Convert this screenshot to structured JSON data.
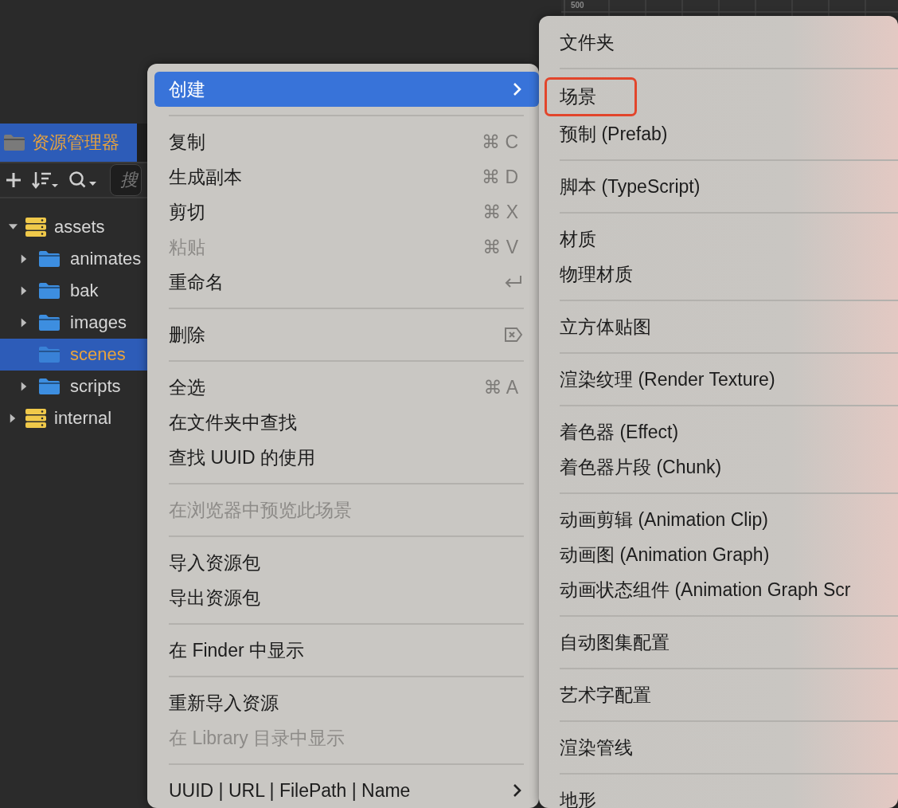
{
  "scene_view": {
    "ruler_label": "500"
  },
  "asset_panel": {
    "title": "资源管理器",
    "search": {
      "placeholder": "搜"
    },
    "tree": [
      {
        "label": "assets",
        "kind": "database",
        "expandable": true,
        "expanded": true,
        "selected": false,
        "children": [
          {
            "label": "animates",
            "kind": "folder",
            "expandable": true,
            "expanded": false,
            "selected": false
          },
          {
            "label": "bak",
            "kind": "folder",
            "expandable": true,
            "expanded": false,
            "selected": false
          },
          {
            "label": "images",
            "kind": "folder",
            "expandable": true,
            "expanded": false,
            "selected": false
          },
          {
            "label": "scenes",
            "kind": "folder",
            "expandable": false,
            "expanded": false,
            "selected": true
          },
          {
            "label": "scripts",
            "kind": "folder",
            "expandable": true,
            "expanded": false,
            "selected": false
          }
        ]
      },
      {
        "label": "internal",
        "kind": "database",
        "expandable": true,
        "expanded": false,
        "selected": false
      }
    ]
  },
  "context_menu": {
    "groups": [
      [
        {
          "label": "创建",
          "selected": true,
          "disabled": false,
          "submenu": true
        }
      ],
      [
        {
          "label": "复制",
          "shortcut": "⌘ C",
          "selected": false,
          "disabled": false,
          "submenu": false
        },
        {
          "label": "生成副本",
          "shortcut": "⌘ D",
          "selected": false,
          "disabled": false,
          "submenu": false
        },
        {
          "label": "剪切",
          "shortcut": "⌘ X",
          "selected": false,
          "disabled": false,
          "submenu": false
        },
        {
          "label": "粘贴",
          "shortcut": "⌘ V",
          "selected": false,
          "disabled": true,
          "submenu": false
        },
        {
          "label": "重命名",
          "kind": "return",
          "selected": false,
          "disabled": false,
          "submenu": false
        }
      ],
      [
        {
          "label": "删除",
          "kind": "delete",
          "selected": false,
          "disabled": false,
          "submenu": false
        }
      ],
      [
        {
          "label": "全选",
          "shortcut": "⌘ A",
          "selected": false,
          "disabled": false,
          "submenu": false
        },
        {
          "label": "在文件夹中查找",
          "selected": false,
          "disabled": false,
          "submenu": false
        },
        {
          "label": "查找 UUID 的使用",
          "selected": false,
          "disabled": false,
          "submenu": false
        }
      ],
      [
        {
          "label": "在浏览器中预览此场景",
          "selected": false,
          "disabled": true,
          "submenu": false
        }
      ],
      [
        {
          "label": "导入资源包",
          "selected": false,
          "disabled": false,
          "submenu": false
        },
        {
          "label": "导出资源包",
          "selected": false,
          "disabled": false,
          "submenu": false
        }
      ],
      [
        {
          "label": "在 Finder 中显示",
          "selected": false,
          "disabled": false,
          "submenu": false
        }
      ],
      [
        {
          "label": "重新导入资源",
          "selected": false,
          "disabled": false,
          "submenu": false
        },
        {
          "label": "在 Library 目录中显示",
          "selected": false,
          "disabled": true,
          "submenu": false
        }
      ],
      [
        {
          "label": "UUID | URL | FilePath | Name",
          "selected": false,
          "disabled": false,
          "submenu": true
        }
      ]
    ]
  },
  "create_submenu": {
    "groups": [
      [
        {
          "label": "文件夹",
          "outlined": false
        }
      ],
      [
        {
          "label": "场景",
          "outlined": true
        },
        {
          "label": "预制 (Prefab)",
          "outlined": false
        }
      ],
      [
        {
          "label": "脚本 (TypeScript)",
          "outlined": false
        }
      ],
      [
        {
          "label": "材质",
          "outlined": false
        },
        {
          "label": "物理材质",
          "outlined": false
        }
      ],
      [
        {
          "label": "立方体贴图",
          "outlined": false
        }
      ],
      [
        {
          "label": "渲染纹理 (Render Texture)",
          "outlined": false
        }
      ],
      [
        {
          "label": "着色器 (Effect)",
          "outlined": false
        },
        {
          "label": "着色器片段 (Chunk)",
          "outlined": false
        }
      ],
      [
        {
          "label": "动画剪辑 (Animation Clip)",
          "outlined": false
        },
        {
          "label": "动画图 (Animation Graph)",
          "outlined": false
        },
        {
          "label": "动画状态组件 (Animation Graph Scr",
          "outlined": false
        }
      ],
      [
        {
          "label": "自动图集配置",
          "outlined": false
        }
      ],
      [
        {
          "label": "艺术字配置",
          "outlined": false
        }
      ],
      [
        {
          "label": "渲染管线",
          "outlined": false
        }
      ],
      [
        {
          "label": "地形",
          "outlined": false
        }
      ]
    ]
  }
}
